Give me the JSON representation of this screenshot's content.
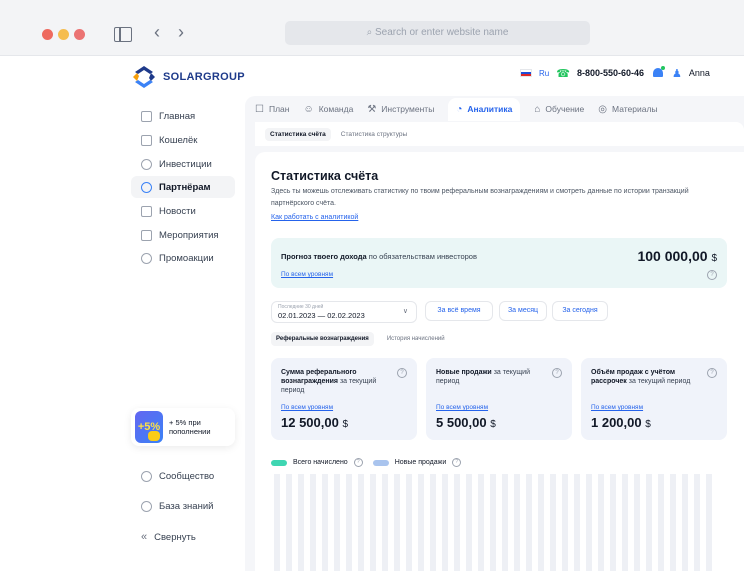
{
  "browser": {
    "url_placeholder": "Search or enter website name"
  },
  "header": {
    "logo_text": "SOLARGROUP",
    "lang": "Ru",
    "phone": "8-800-550-60-46",
    "user_name": "Anna"
  },
  "sidebar": {
    "items": [
      {
        "label": "Главная",
        "icon": "home-icon"
      },
      {
        "label": "Кошелёк",
        "icon": "wallet-icon"
      },
      {
        "label": "Инвестиции",
        "icon": "dollar-icon"
      },
      {
        "label": "Партнёрам",
        "icon": "partners-icon"
      },
      {
        "label": "Новости",
        "icon": "news-icon"
      },
      {
        "label": "Мероприятия",
        "icon": "calendar-icon"
      },
      {
        "label": "Промоакции",
        "icon": "promo-icon"
      }
    ],
    "promo": {
      "badge": "+5%",
      "text": "+ 5% при пополнении"
    },
    "bottom": [
      {
        "label": "Сообщество",
        "icon": "community-icon"
      },
      {
        "label": "База знаний",
        "icon": "help-icon"
      },
      {
        "label": "Свернуть",
        "icon": "collapse-icon"
      }
    ]
  },
  "tabs": [
    {
      "label": "План",
      "icon": "plan-icon"
    },
    {
      "label": "Команда",
      "icon": "team-icon"
    },
    {
      "label": "Инструменты",
      "icon": "tools-icon"
    },
    {
      "label": "Аналитика",
      "icon": "analytics-icon"
    },
    {
      "label": "Обучение",
      "icon": "education-icon"
    },
    {
      "label": "Материалы",
      "icon": "materials-icon"
    }
  ],
  "subtabs": [
    "Статистика счёта",
    "Статистика структуры"
  ],
  "page": {
    "title": "Статистика счёта",
    "description": "Здесь ты можешь отслеживать статистику по твоим реферальным вознаграждениям и смотреть данные по истории транзакций партнёрского счёта.",
    "how_link": "Как работать с аналитикой"
  },
  "forecast": {
    "label_bold": "Прогноз твоего дохода",
    "label_rest": " по обязательствам инвесторов",
    "link": "По всем уровням",
    "value": "100 000,00",
    "currency": "$"
  },
  "filters": {
    "date_caption": "Последние 30 дней",
    "date_value": "02.01.2023 — 02.02.2023",
    "periods": [
      "За всё время",
      "За месяц",
      "За сегодня"
    ]
  },
  "reward_tabs": [
    "Реферальные вознаграждения",
    "История начислений"
  ],
  "stats": [
    {
      "title_bold": "Сумма реферального вознаграждения",
      "title_rest": " за текущий период",
      "link": "По всем уровням",
      "value": "12 500,00",
      "currency": "$"
    },
    {
      "title_bold": "Новые продажи",
      "title_rest": " за текущий период",
      "link": "По всем уровням",
      "value": "5 500,00",
      "currency": "$"
    },
    {
      "title_bold": "Объём продаж с учётом рассрочек",
      "title_rest": " за текущий период",
      "link": "По всем уровням",
      "value": "1 200,00",
      "currency": "$"
    }
  ],
  "legend": {
    "total_label": "Всего начислено",
    "sales_label": "Новые продажи"
  },
  "colors": {
    "accent": "#2563eb",
    "total_series": "#3fd6b2",
    "sales_series": "#a9c4ee",
    "forecast_bg": "#eaf6f6"
  },
  "chart_data": {
    "type": "bar",
    "series": [
      {
        "name": "Всего начислено",
        "values": [
          0,
          0,
          0,
          0,
          0,
          0,
          0,
          0,
          0,
          0,
          0,
          0,
          0,
          0,
          0,
          0,
          0,
          0,
          0,
          0,
          0,
          0,
          0,
          0,
          0,
          0,
          0,
          0,
          0,
          0,
          0,
          0,
          0,
          0,
          0,
          0,
          0,
          0,
          0,
          0,
          0,
          0,
          0,
          0,
          0,
          0,
          0,
          0,
          0,
          0,
          0,
          0,
          0,
          0,
          0,
          0,
          0,
          0,
          0,
          0,
          0,
          0,
          0,
          0,
          0,
          0,
          0,
          0,
          0,
          0,
          0,
          0,
          0,
          0,
          0,
          0,
          0,
          0,
          0,
          0,
          0,
          0,
          0,
          0,
          0,
          0,
          0,
          0,
          0,
          0
        ]
      },
      {
        "name": "Новые продажи",
        "values": []
      }
    ]
  }
}
